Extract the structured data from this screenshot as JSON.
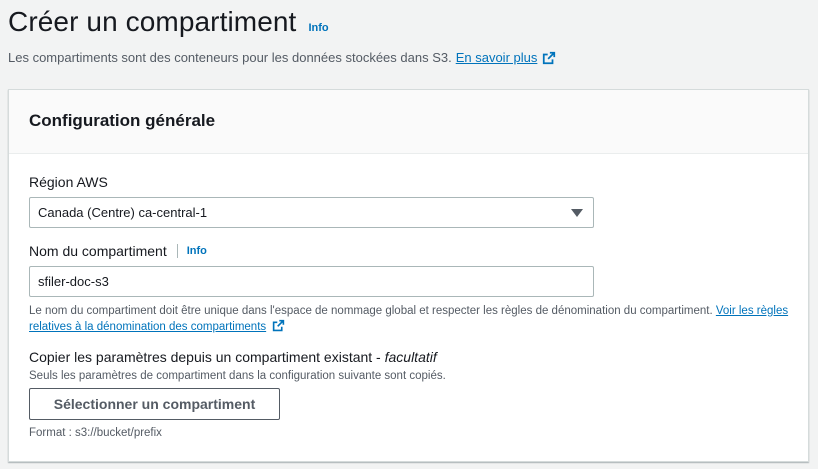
{
  "header": {
    "title": "Créer un compartiment",
    "info_label": "Info",
    "subtitle": "Les compartiments sont des conteneurs pour les données stockées dans S3.",
    "learn_more": "En savoir plus"
  },
  "panel": {
    "title": "Configuration générale",
    "region": {
      "label": "Région AWS",
      "value": "Canada (Centre) ca-central-1"
    },
    "bucket_name": {
      "label": "Nom du compartiment",
      "info_label": "Info",
      "value": "sfiler-doc-s3",
      "help_text": "Le nom du compartiment doit être unique dans l'espace de nommage global et respecter les règles de dénomination du compartiment.",
      "help_link": "Voir les règles relatives à la dénomination des compartiments"
    },
    "copy_settings": {
      "label": "Copier les paramètres depuis un compartiment existant - ",
      "optional": "facultatif",
      "description": "Seuls les paramètres de compartiment dans la configuration suivante sont copiés.",
      "button_label": "Sélectionner un compartiment",
      "format_hint": "Format : s3://bucket/prefix"
    }
  },
  "colors": {
    "link": "#0073bb",
    "background": "#f2f3f3",
    "text": "#16191f",
    "secondary_text": "#545b64"
  },
  "icons": {
    "external_link": "external-link-icon",
    "dropdown": "caret-down-icon"
  }
}
